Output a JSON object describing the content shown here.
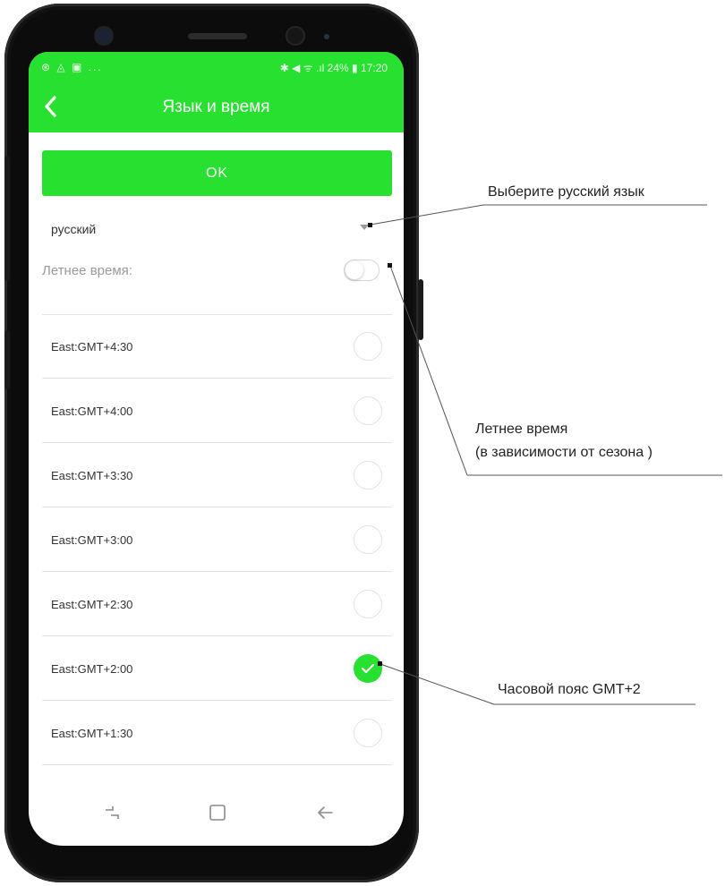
{
  "status_bar": {
    "left_icons": "⊛ ◬ ▣ ...",
    "right": "✱ ◀ ᯤ .ıl 24% ▮ 17:20"
  },
  "app_bar": {
    "back_icon": "chevron-left-icon",
    "title": "Язык и время"
  },
  "ok_label": "OK",
  "language": {
    "selected": "русский",
    "icon": "dropdown-arrow-icon"
  },
  "summer_time": {
    "label": "Летнее время:",
    "enabled": false
  },
  "timezones": [
    {
      "label": "East:GMT+4:30",
      "selected": false
    },
    {
      "label": "East:GMT+4:00",
      "selected": false
    },
    {
      "label": "East:GMT+3:30",
      "selected": false
    },
    {
      "label": "East:GMT+3:00",
      "selected": false
    },
    {
      "label": "East:GMT+2:30",
      "selected": false
    },
    {
      "label": "East:GMT+2:00",
      "selected": true
    },
    {
      "label": "East:GMT+1:30",
      "selected": false
    }
  ],
  "nav_bar": [
    "recents-icon",
    "home-icon",
    "back-arrow-icon"
  ],
  "annotations": {
    "language": "Выберите русский язык",
    "summer_line1": "Летнее время",
    "summer_line2": "(в зависимости от сезона )",
    "timezone": "Часовой пояс GMT+2"
  },
  "colors": {
    "accent": "#27e02f",
    "phone_body": "#0c0c0c"
  }
}
